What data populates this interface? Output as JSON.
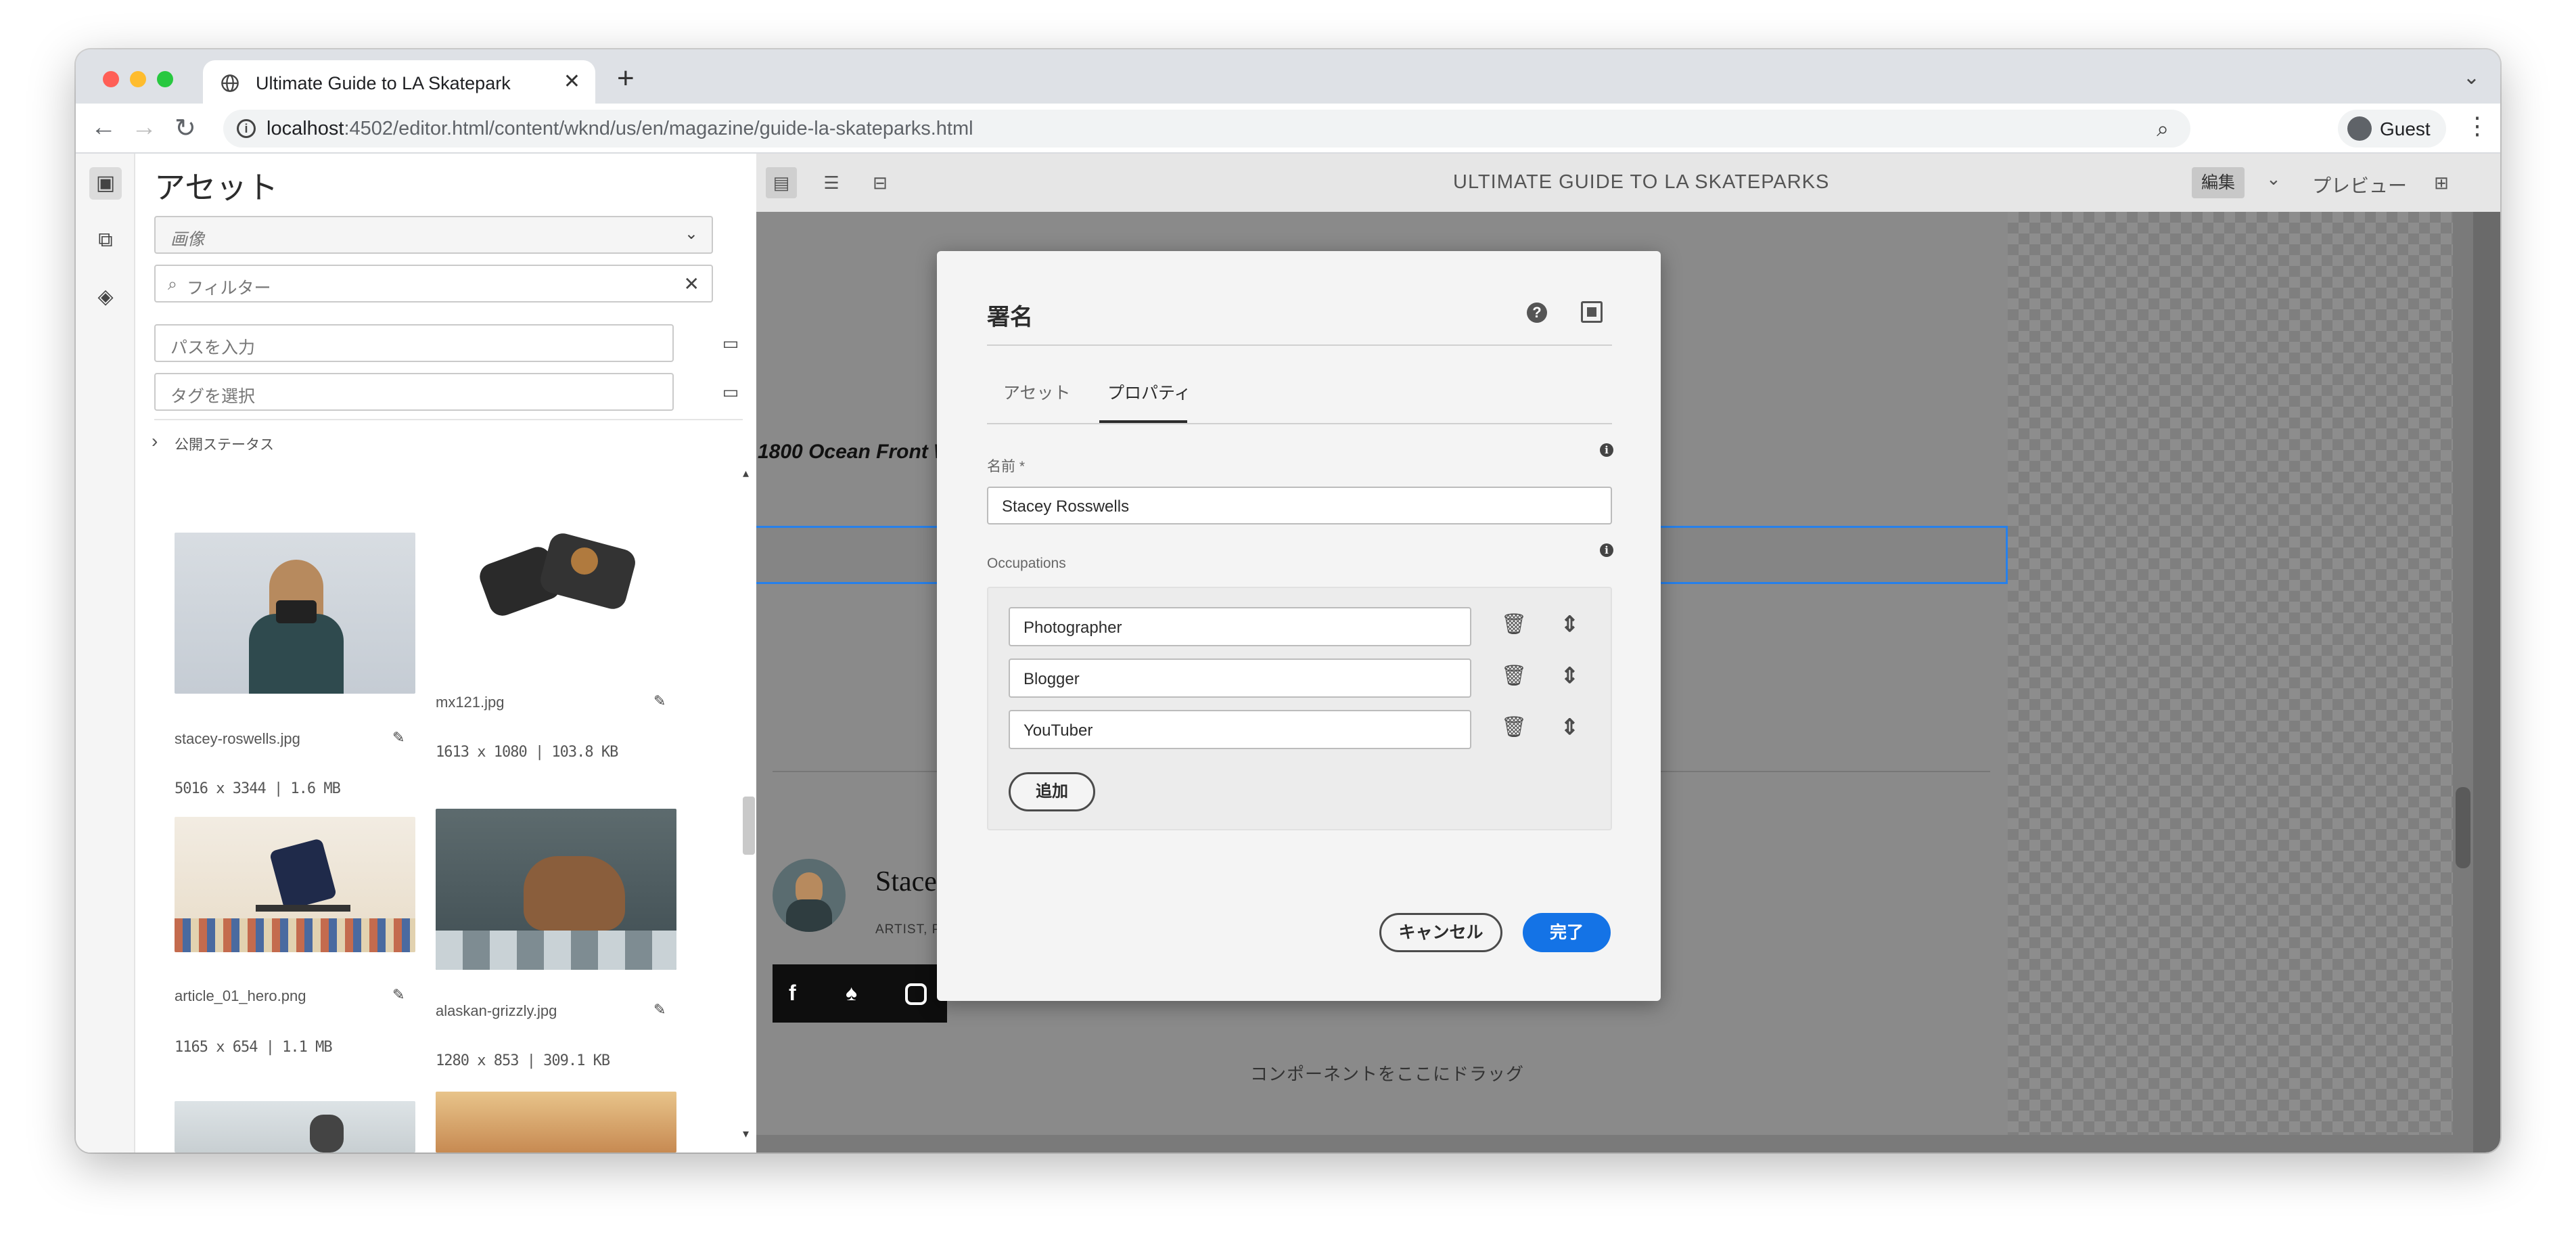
{
  "browser": {
    "tab_title": "Ultimate Guide to LA Skatepark",
    "new_tab_icon": "+",
    "url_host": "localhost",
    "url_rest": ":4502/editor.html/content/wknd/us/en/magazine/guide-la-skateparks.html",
    "profile_label": "Guest",
    "traffic_colors": [
      "#ff5f57",
      "#febc2e",
      "#28c840"
    ]
  },
  "assets_panel": {
    "title": "アセット",
    "type_select_placeholder": "画像",
    "filter_placeholder": "フィルター",
    "path_placeholder": "パスを入力",
    "tag_placeholder": "タグを選択",
    "publish_status_label": "公開ステータス",
    "items": [
      {
        "filename": "stacey-roswells.jpg",
        "meta": "5016 x 3344 | 1.6 MB"
      },
      {
        "filename": "mx121.jpg",
        "meta": "1613 x 1080 | 103.8 KB"
      },
      {
        "filename": "article_01_hero.png",
        "meta": "1165 x 654 | 1.1 MB"
      },
      {
        "filename": "alaskan-grizzly.jpg",
        "meta": "1280 x 853 | 309.1 KB"
      }
    ]
  },
  "editor": {
    "page_title": "ULTIMATE GUIDE TO LA SKATEPARKS",
    "edit_mode_label": "編集",
    "preview_label": "プレビュー",
    "page": {
      "address_text": "1800 Ocean Front W",
      "byline_name": "Stace",
      "byline_role": "ARTIST, P",
      "drag_hint": "コンポーネントをここにドラッグ"
    }
  },
  "dialog": {
    "title": "署名",
    "tabs": [
      "アセット",
      "プロパティ"
    ],
    "active_tab": "プロパティ",
    "name_label": "名前 *",
    "name_value": "Stacey Rosswells",
    "occupations_label": "Occupations",
    "occupations": [
      "Photographer",
      "Blogger",
      "YouTuber"
    ],
    "add_label": "追加",
    "cancel_label": "キャンセル",
    "done_label": "完了",
    "accent_color": "#1473e6"
  }
}
